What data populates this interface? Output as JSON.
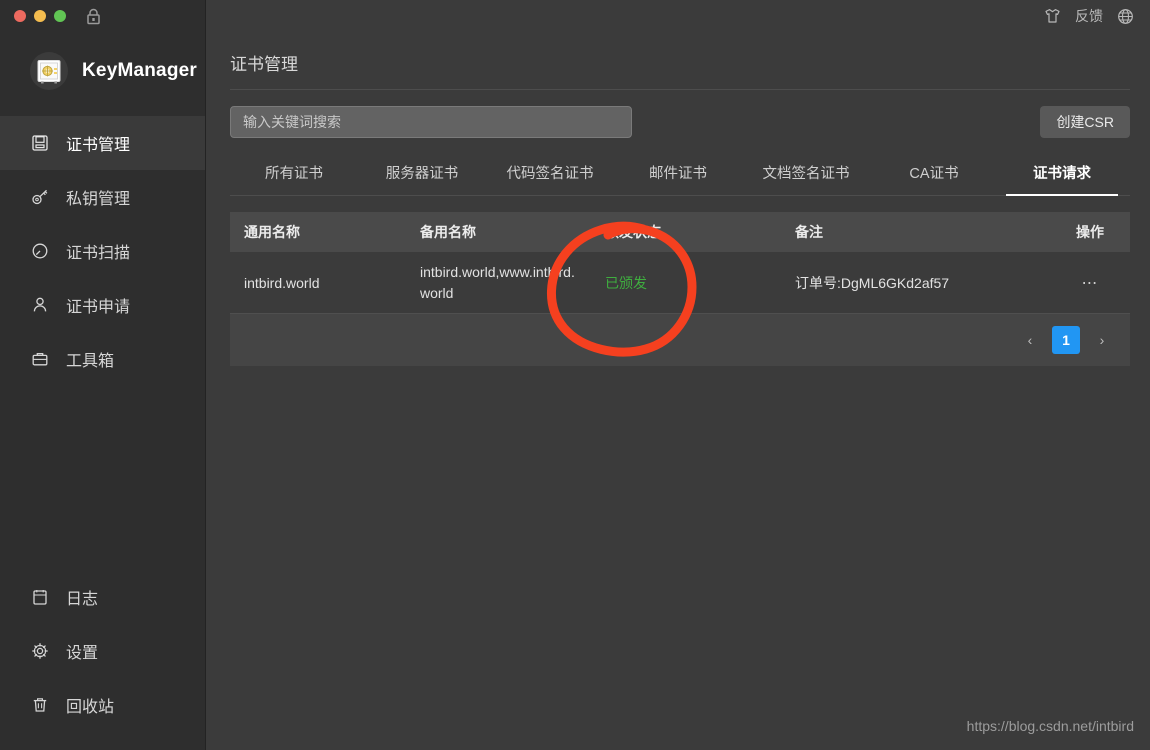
{
  "window": {
    "traffic_lights": [
      "close",
      "minimize",
      "zoom"
    ],
    "lock_icon": "lock-icon"
  },
  "brand": {
    "name": "KeyManager",
    "logo_icon": "safe-vault-icon"
  },
  "sidebar": {
    "items": [
      {
        "label": "证书管理",
        "icon": "certificate-icon",
        "active": true
      },
      {
        "label": "私钥管理",
        "icon": "key-icon",
        "active": false
      },
      {
        "label": "证书扫描",
        "icon": "scan-icon",
        "active": false
      },
      {
        "label": "证书申请",
        "icon": "person-icon",
        "active": false
      },
      {
        "label": "工具箱",
        "icon": "toolbox-icon",
        "active": false
      }
    ],
    "bottom_items": [
      {
        "label": "日志",
        "icon": "log-icon"
      },
      {
        "label": "设置",
        "icon": "gear-icon"
      },
      {
        "label": "回收站",
        "icon": "trash-icon"
      }
    ]
  },
  "topbar": {
    "skin_icon": "tshirt-icon",
    "feedback_label": "反馈",
    "language_icon": "globe-icon"
  },
  "header": {
    "page_title": "证书管理"
  },
  "toolbar": {
    "search_placeholder": "输入关键词搜索",
    "search_value": "",
    "create_csr_label": "创建CSR"
  },
  "tabs": [
    {
      "label": "所有证书",
      "active": false
    },
    {
      "label": "服务器证书",
      "active": false
    },
    {
      "label": "代码签名证书",
      "active": false
    },
    {
      "label": "邮件证书",
      "active": false
    },
    {
      "label": "文档签名证书",
      "active": false
    },
    {
      "label": "CA证书",
      "active": false
    },
    {
      "label": "证书请求",
      "active": true
    }
  ],
  "table": {
    "columns": [
      "通用名称",
      "备用名称",
      "颁发状态",
      "备注",
      "操作"
    ],
    "rows": [
      {
        "common_name": "intbird.world",
        "alt_name": "intbird.world,www.intbird.world",
        "status": "已颁发",
        "status_color": "#3fae3f",
        "remark": "订单号:DgML6GKd2af57",
        "action_icon": "ellipsis-icon"
      }
    ]
  },
  "pagination": {
    "prev_label": "‹",
    "pages": [
      "1"
    ],
    "current_page": "1",
    "next_label": "›",
    "accent_color": "#2196f3"
  },
  "watermark": {
    "text": "https://blog.csdn.net/intbird"
  },
  "annotation": {
    "type": "hand-drawn-circle",
    "color": "#f5401f",
    "target": "已颁发"
  }
}
